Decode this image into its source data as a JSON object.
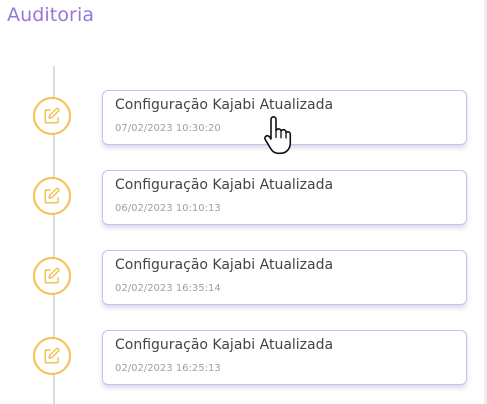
{
  "page": {
    "title": "Auditoria"
  },
  "colors": {
    "title": "#9676de",
    "icon_ring": "#f5c04d",
    "card_border": "#c8c0f0",
    "timeline": "#dcdcdc"
  },
  "entries": [
    {
      "title": "Configuração Kajabi Atualizada",
      "date": "07/02/2023 10:30:20",
      "icon": "edit-icon"
    },
    {
      "title": "Configuração Kajabi Atualizada",
      "date": "06/02/2023 10:10:13",
      "icon": "edit-icon"
    },
    {
      "title": "Configuração Kajabi Atualizada",
      "date": "02/02/2023 16:35:14",
      "icon": "edit-icon"
    },
    {
      "title": "Configuração Kajabi Atualizada",
      "date": "02/02/2023 16:25:13",
      "icon": "edit-icon"
    }
  ],
  "cursor": "hand-pointer-icon"
}
